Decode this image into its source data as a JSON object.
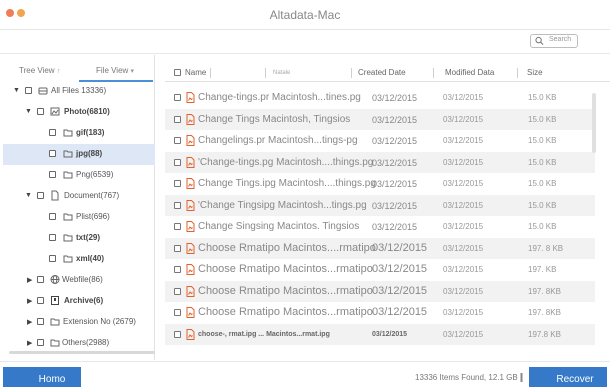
{
  "app": {
    "title": "Altadata-Mac",
    "traffic_colors": [
      "#f07d55",
      "#f3a54d"
    ]
  },
  "search": {
    "placeholder": "Search"
  },
  "sidebar": {
    "tabs": [
      {
        "label": "Tree View",
        "arrow": "↑"
      },
      {
        "label": "File View",
        "arrow": "▾"
      }
    ],
    "items": [
      {
        "label": "All Files 13336)",
        "bold": false,
        "icon": "hard-drive-icon",
        "expanded": true
      },
      {
        "label": "Photo(6810)",
        "bold": true,
        "icon": "image-icon",
        "expanded": true
      },
      {
        "label": "gif(183)",
        "bold": true,
        "icon": "folder-icon"
      },
      {
        "label": "jpg(88)",
        "bold": true,
        "icon": "folder-icon",
        "selected": true
      },
      {
        "label": "Png(6539)",
        "bold": false,
        "icon": "folder-icon"
      },
      {
        "label": "Document(767)",
        "bold": false,
        "icon": "document-icon",
        "expanded": true
      },
      {
        "label": "Plist(696)",
        "bold": false,
        "icon": "folder-icon"
      },
      {
        "label": "txt(29)",
        "bold": true,
        "icon": "folder-icon"
      },
      {
        "label": "xml(40)",
        "bold": true,
        "icon": "folder-icon"
      },
      {
        "label": "Webfile(86)",
        "bold": false,
        "icon": "globe-icon",
        "expanded": false
      },
      {
        "label": "Archive(6)",
        "bold": true,
        "icon": "archive-icon",
        "expanded": false
      },
      {
        "label": "Extension No (2679)",
        "bold": false,
        "icon": "folder-icon",
        "expanded": false
      },
      {
        "label": "Others(2988)",
        "bold": false,
        "icon": "folder-icon",
        "expanded": false
      }
    ]
  },
  "table": {
    "columns": [
      "Name",
      "Natale",
      "Created Date",
      "Modified Data",
      "Size"
    ],
    "rows": [
      {
        "name": "Change-tings.pr Macintosh...tines.pg",
        "created": "03/12/2015",
        "modified": "03/12/2015",
        "size": "15.0 KB"
      },
      {
        "name": "Change Tings Macintosh, Tingsios",
        "created": "03/12/2015",
        "modified": "03/12/2015",
        "size": "15.0 KB"
      },
      {
        "name": "Changelings.pr Macintosh...tings-pg",
        "created": "03/12/2015",
        "modified": "03/12/2015",
        "size": "15.0 KB"
      },
      {
        "name": "'Change-tings.pg Macintosh....things.pg",
        "created": "03/12/2015",
        "modified": "03/12/2015",
        "size": "15.0 KB"
      },
      {
        "name": "Change Tings.ipg Macintosh....things.pg",
        "created": "03/12/2015",
        "modified": "03/12/2015",
        "size": "15.0 KB"
      },
      {
        "name": "'Change Tingsipg Macintosh...tings.pg",
        "created": "03/12/2015",
        "modified": "03/12/2015",
        "size": "15.0 KB"
      },
      {
        "name": "Change Singsing Macintos. Tingsios",
        "created": "03/12/2015",
        "modified": "03/12/2015",
        "size": "15.0 KB"
      },
      {
        "name": "Choose Rmatipo Macintos....rmatipo",
        "created": "03/12/2015",
        "modified": "03/12/2015",
        "size": "197. 8 KB"
      },
      {
        "name": "Choose Rmatipo Macintos...rmatipo",
        "created": "03/12/2015",
        "modified": "03/12/2015",
        "size": "197. KB"
      },
      {
        "name": "Choose Rmatipo Macintos...rmatipo",
        "created": "03/12/2015",
        "modified": "03/12/2015",
        "size": "197. 8KB"
      },
      {
        "name": "Choose Rmatipo Macintos...rmatipo",
        "created": "03/12/2015",
        "modified": "03/12/2015",
        "size": "197. 8KB"
      },
      {
        "name": "choose-, rmat.ipg ... Macintos...rmat.ipg",
        "created": "03/12/2015",
        "modified": "03/12/2015",
        "size": "197.8 KB"
      }
    ]
  },
  "footer": {
    "home_label": "Homo",
    "found_text": "13336 Items Found, 12.1 GB",
    "recover_label": "Recover",
    "button_color": "#3579c8"
  }
}
